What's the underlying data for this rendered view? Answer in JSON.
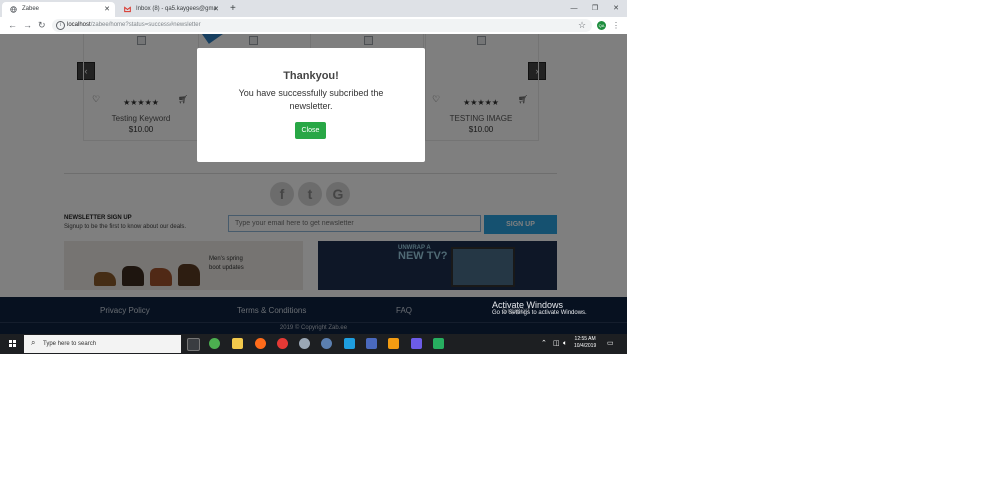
{
  "browser": {
    "tabs": [
      {
        "title": "Zabee",
        "active": true
      },
      {
        "title": "Inbox (8) - qa5.kaygees@gmail.c",
        "active": false
      }
    ],
    "address": {
      "host": "localhost",
      "path": "/zabee/home?status=success#newsletter"
    },
    "profile_initials": "QA"
  },
  "products": [
    {
      "name": "Testing Keyword",
      "price": "$10.00",
      "rating": "★★★★★"
    },
    {
      "name": "TESTING IMAGE",
      "price": "$10.00",
      "rating": "★★★★★"
    }
  ],
  "social": [
    "f",
    "t",
    "G"
  ],
  "newsletter": {
    "title": "NEWSLETTER SIGN UP",
    "subtitle": "Signup to be the first to know about our deals.",
    "placeholder": "Type your email here to get newsletter",
    "button": "SIGN UP"
  },
  "banners": {
    "left_text_1": "Men's spring",
    "left_text_2": "boot updates",
    "right_text_1": "UNWRAP A",
    "right_text_2": "NEW TV?"
  },
  "footer": {
    "links": [
      "Privacy Policy",
      "Terms & Conditions",
      "FAQ",
      "Support"
    ],
    "copyright": "2019 © Copyright Zab.ee"
  },
  "watermark": {
    "line1": "Activate Windows",
    "line2": "Go to Settings to activate Windows."
  },
  "modal": {
    "title": "Thankyou!",
    "message": "You have successfully subcribed the newsletter.",
    "close": "Close"
  },
  "taskbar": {
    "search_placeholder": "Type here to search",
    "time": "12:55 AM",
    "date": "10/4/2019"
  },
  "colors": {
    "footer": "#0e2340",
    "signup": "#2aa3e0",
    "close_button": "#28a745"
  }
}
